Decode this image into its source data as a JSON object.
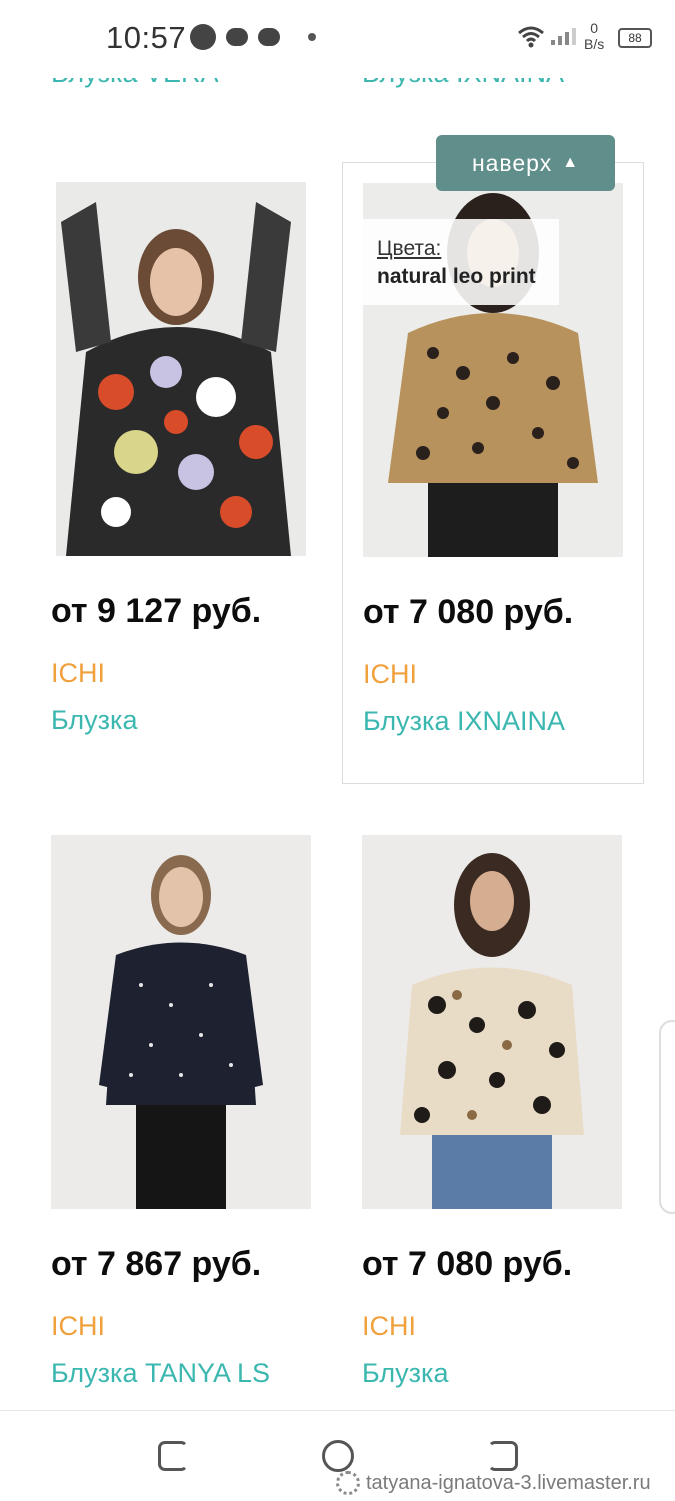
{
  "status_bar": {
    "time": "10:57",
    "net_speed_value": "0",
    "net_speed_unit": "B/s",
    "battery": "88"
  },
  "previous_row": {
    "left_title": "Блузка VERA",
    "right_title": "Блузка IXNAINA"
  },
  "to_top_button": {
    "label": "наверх",
    "arrow": "▲"
  },
  "colors_popup": {
    "label": "Цвета:",
    "value": "natural leo print"
  },
  "products": [
    {
      "price": "от 9 127 руб.",
      "brand": "ICHI",
      "name": "Блузка"
    },
    {
      "price": "от 7 080 руб.",
      "brand": "ICHI",
      "name": "Блузка IXNAINA"
    },
    {
      "price": "от 7 867 руб.",
      "brand": "ICHI",
      "name": "Блузка TANYA LS"
    },
    {
      "price": "от 7 080 руб.",
      "brand": "ICHI",
      "name": "Блузка"
    }
  ],
  "watermark": "tatyana-ignatova-3.livemaster.ru",
  "colors": {
    "accent_teal": "#3bb7b0",
    "brand_orange": "#f0a03c",
    "button_bg": "#5f8e8b"
  },
  "icons": [
    "wifi-icon",
    "signal-icon",
    "battery-icon",
    "recent-apps-icon",
    "home-icon",
    "back-icon"
  ]
}
